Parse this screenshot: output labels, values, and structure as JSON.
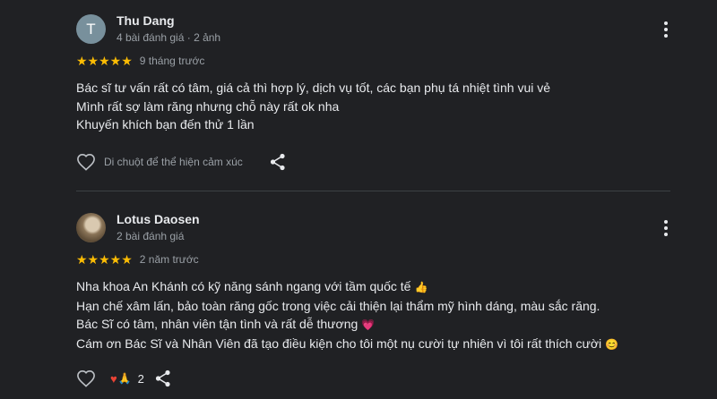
{
  "reviews": [
    {
      "avatar_letter": "T",
      "name": "Thu Dang",
      "meta": "4 bài đánh giá · 2 ảnh",
      "stars": "★★★★★",
      "rating": 5,
      "time": "9 tháng trước",
      "lines": [
        "Bác sĩ tư vấn rất có tâm, giá cả thì hợp lý, dịch vụ tốt, các bạn phụ tá nhiệt tình vui vẻ",
        "Mình rất sợ làm răng nhưng chỗ này rất ok nha",
        "Khuyến khích bạn đến thử 1 lần"
      ],
      "react_hint": "Di chuột để thể hiện cảm xúc"
    },
    {
      "name": "Lotus Daosen",
      "meta": "2 bài đánh giá",
      "stars": "★★★★★",
      "rating": 5,
      "time": "2 năm trước",
      "lines": [
        "Nha khoa An Khánh có kỹ năng sánh ngang với tầm quốc tế",
        "Hạn chế xâm lấn, bảo toàn răng gốc trong việc cải thiện lại thẩm mỹ hình dáng, màu sắc răng.",
        "Bác Sĩ có tâm, nhân viên tận tình và rất dễ thương",
        "Cám ơn Bác Sĩ và Nhân Viên đã tạo điều kiện cho tôi một nụ cười tự nhiên vì tôi rất thích cười"
      ],
      "line_emojis": [
        "👍",
        "",
        "💗",
        "😊"
      ],
      "reaction_icons": [
        "♥",
        "🙏"
      ],
      "reaction_count": "2"
    }
  ],
  "colors": {
    "background": "#202124",
    "star": "#fbbc04",
    "secondary_text": "#9aa0a6"
  },
  "icons": [
    "more-vert-icon",
    "heart-outline-icon",
    "share-icon",
    "heart-reaction-icon",
    "pray-reaction-icon"
  ]
}
